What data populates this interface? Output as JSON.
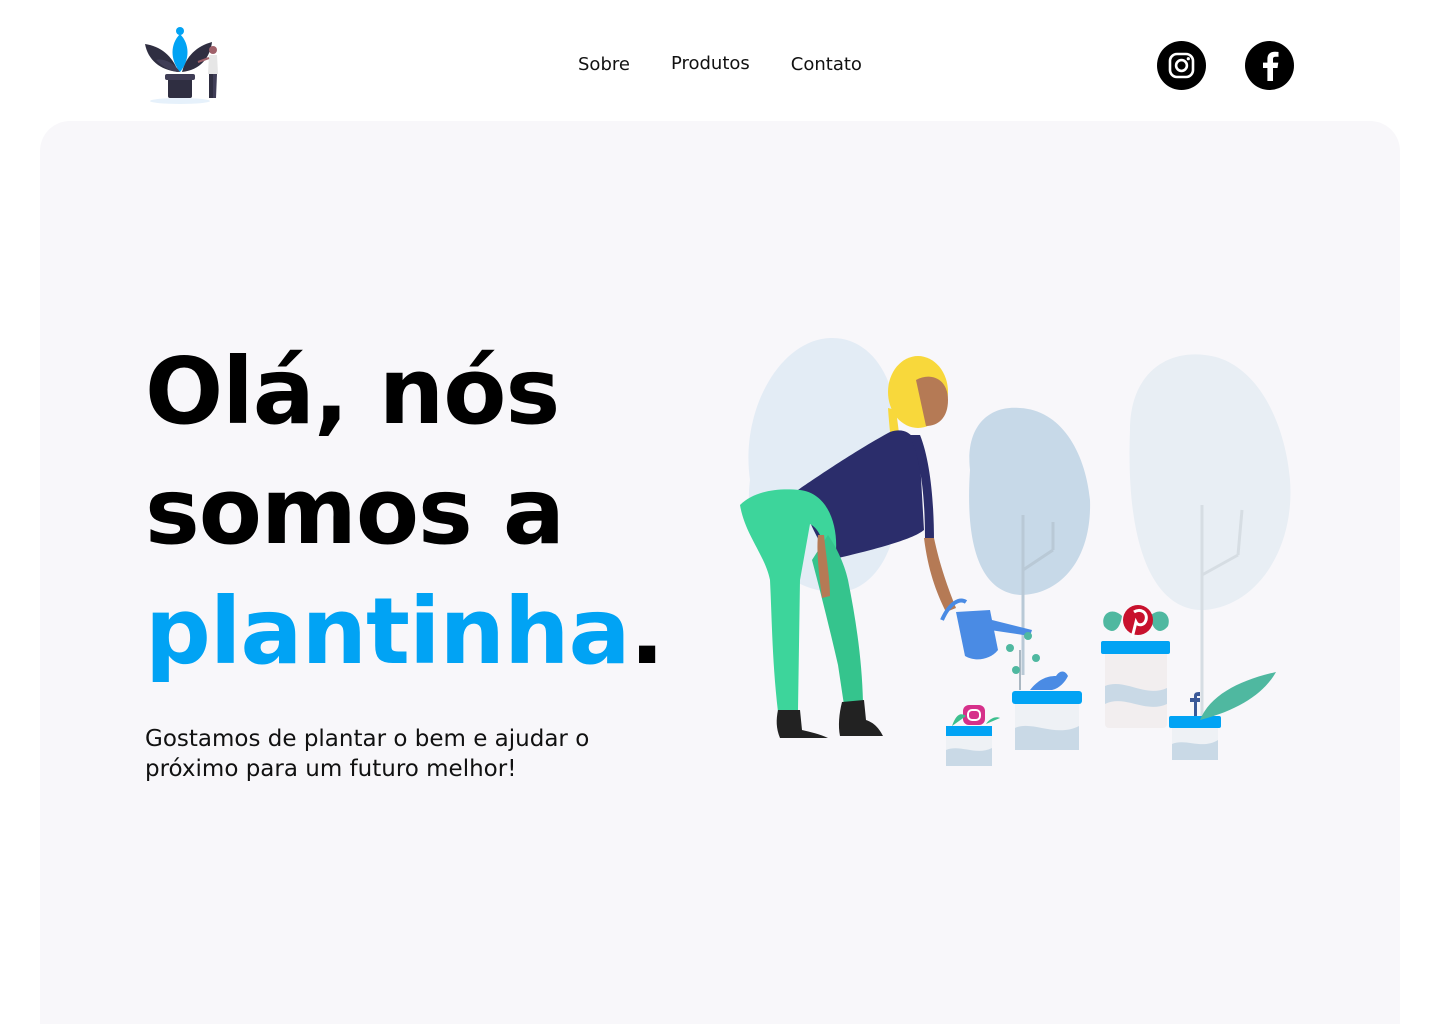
{
  "header": {
    "logo_icon": "plant-logo-icon",
    "nav": [
      {
        "label": "Sobre"
      },
      {
        "label": "Produtos"
      },
      {
        "label": "Contato"
      }
    ],
    "social": [
      {
        "icon": "instagram-icon"
      },
      {
        "icon": "facebook-icon"
      }
    ]
  },
  "hero": {
    "headline_line1": "Olá, nós",
    "headline_line2": "somos a",
    "headline_accent": "plantinha",
    "headline_period": ".",
    "subtitle": "Gostamos de plantar o bem e ajudar o próximo para um futuro melhor!",
    "illustration_icon": "gardening-woman-illustration"
  },
  "colors": {
    "accent": "#01a3f4",
    "background": "#ffffff",
    "hero_background": "#f8f7fa",
    "text": "#000000"
  }
}
